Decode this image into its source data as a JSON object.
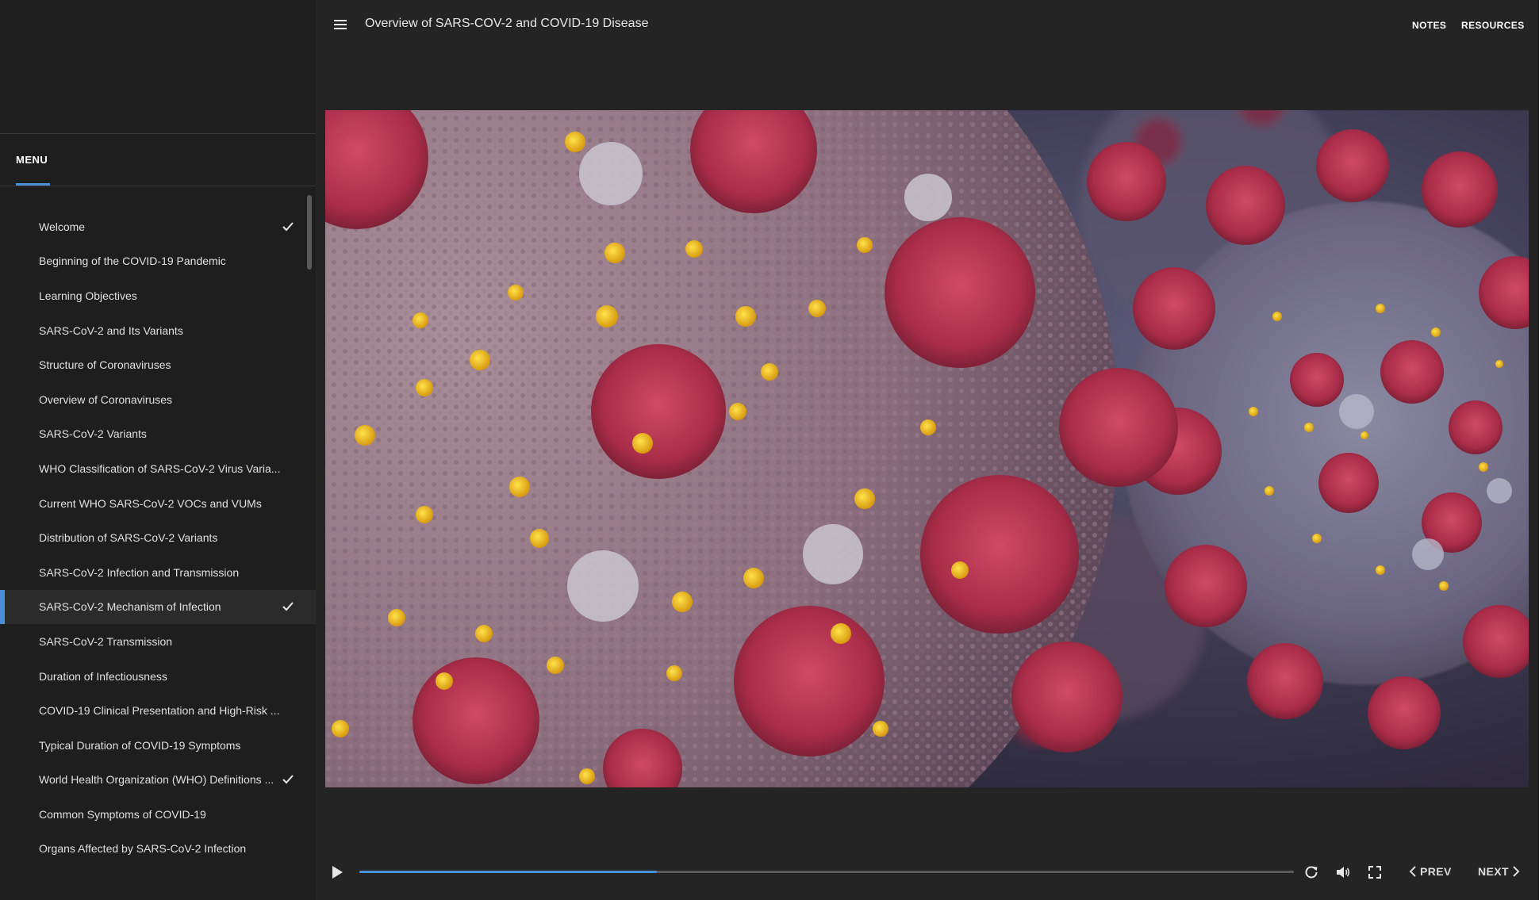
{
  "app": {
    "course_title": "Overview of SARS-COV-2 and COVID-19 Disease",
    "notes_label": "NOTES",
    "resources_label": "RESOURCES"
  },
  "sidebar": {
    "menu_tab_label": "MENU",
    "items": [
      {
        "label": "Welcome",
        "completed": true,
        "active": false
      },
      {
        "label": "Beginning of the COVID-19 Pandemic",
        "completed": false,
        "active": false
      },
      {
        "label": "Learning Objectives",
        "completed": false,
        "active": false
      },
      {
        "label": "SARS-CoV-2 and Its Variants",
        "completed": false,
        "active": false
      },
      {
        "label": "Structure of Coronaviruses",
        "completed": false,
        "active": false
      },
      {
        "label": "Overview of Coronaviruses",
        "completed": false,
        "active": false
      },
      {
        "label": "SARS-CoV-2 Variants",
        "completed": false,
        "active": false
      },
      {
        "label": "WHO Classification of SARS-CoV-2 Virus Varia...",
        "completed": false,
        "active": false
      },
      {
        "label": "Current WHO SARS-CoV-2 VOCs and VUMs",
        "completed": false,
        "active": false
      },
      {
        "label": "Distribution of SARS-CoV-2 Variants",
        "completed": false,
        "active": false
      },
      {
        "label": "SARS-CoV-2 Infection and Transmission",
        "completed": false,
        "active": false
      },
      {
        "label": "SARS-CoV-2 Mechanism of Infection",
        "completed": true,
        "active": true
      },
      {
        "label": "SARS-CoV-2 Transmission",
        "completed": false,
        "active": false
      },
      {
        "label": "Duration of Infectiousness",
        "completed": false,
        "active": false
      },
      {
        "label": "COVID-19 Clinical Presentation and High-Risk ...",
        "completed": false,
        "active": false
      },
      {
        "label": "Typical Duration of COVID-19 Symptoms",
        "completed": false,
        "active": false
      },
      {
        "label": "World Health Organization (WHO) Definitions ...",
        "completed": true,
        "active": false
      },
      {
        "label": "Common Symptoms of COVID-19",
        "completed": false,
        "active": false
      },
      {
        "label": "Organs Affected by SARS-CoV-2 Infection",
        "completed": false,
        "active": false
      }
    ]
  },
  "player": {
    "progress_fraction": 0.318,
    "prev_label": "PREV",
    "next_label": "NEXT",
    "icons": [
      "play-icon",
      "replay-icon",
      "volume-icon",
      "fullscreen-icon",
      "chevron-left-icon",
      "chevron-right-icon",
      "menu-icon",
      "check-icon"
    ]
  },
  "colors": {
    "accent": "#4a90d9",
    "sidebar_bg": "#1e1e1e",
    "main_bg": "#242424",
    "active_item_bg": "#2b2b2b"
  }
}
